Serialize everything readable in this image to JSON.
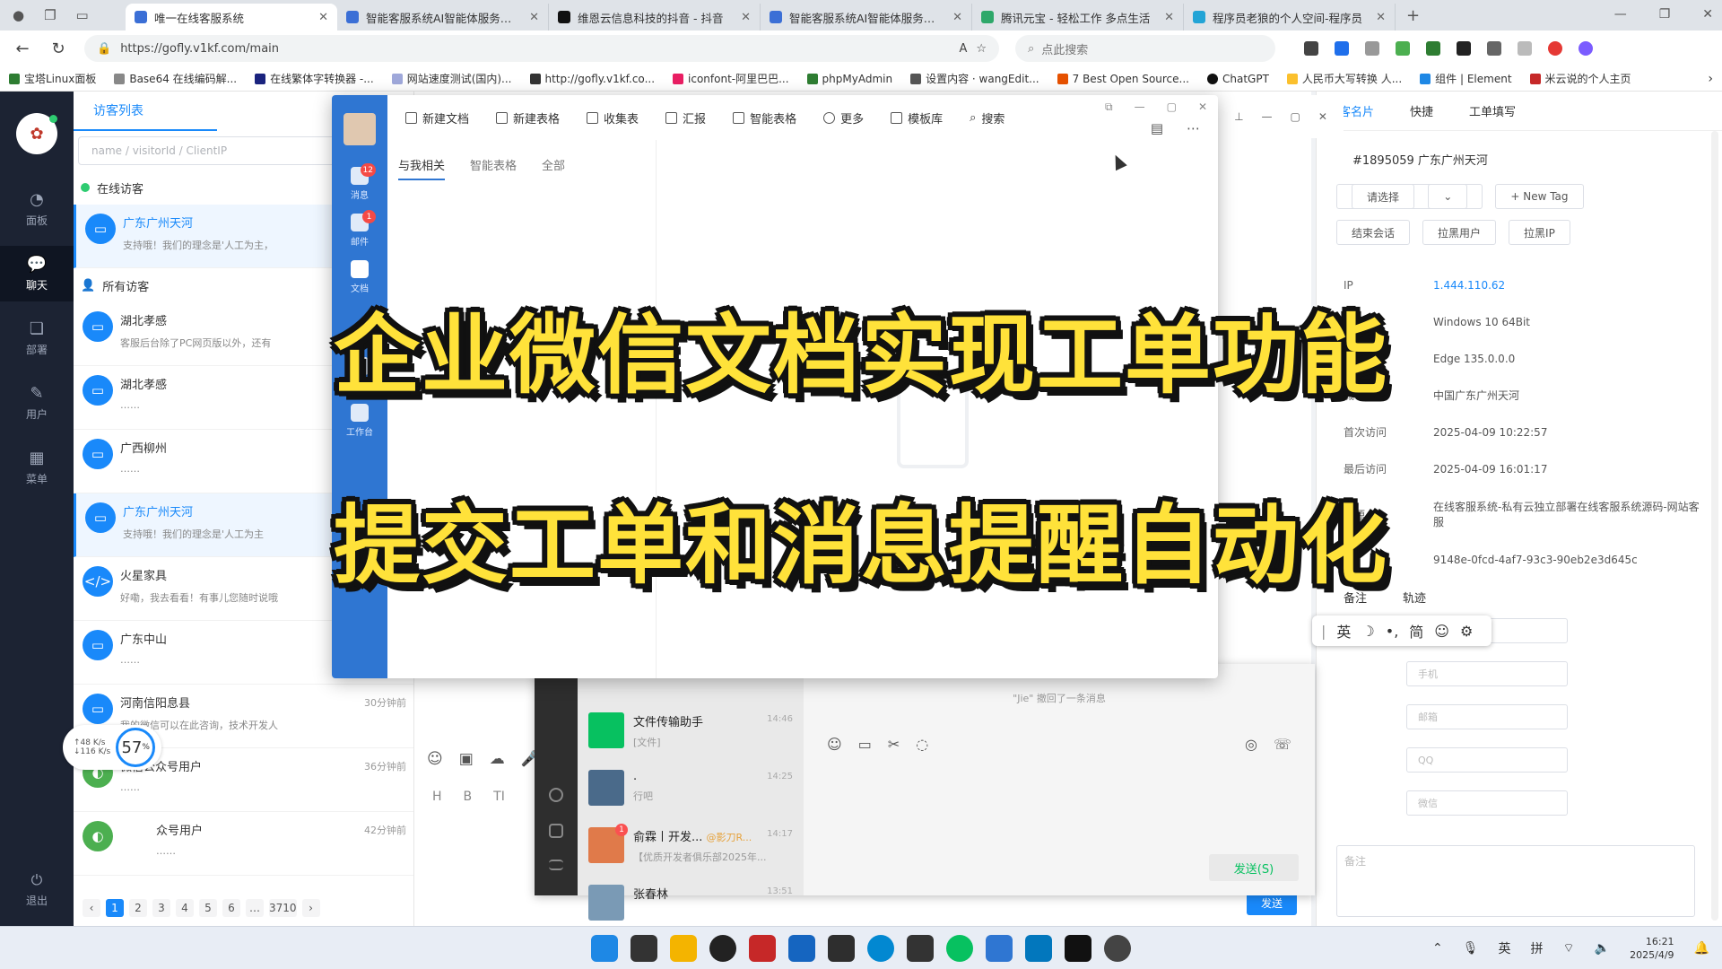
{
  "browser": {
    "tabs": [
      {
        "title": "唯一在线客服系统",
        "active": true
      },
      {
        "title": "智能客服系统AI智能体服务平台"
      },
      {
        "title": "维恩云信息科技的抖音 - 抖音"
      },
      {
        "title": "智能客服系统AI智能体服务平台"
      },
      {
        "title": "腾讯元宝 - 轻松工作 多点生活"
      },
      {
        "title": "程序员老狼的个人空间-程序员"
      }
    ],
    "url": "https://gofly.v1kf.com/main",
    "search_placeholder": "点此搜索",
    "bookmarks": [
      "宝塔Linux面板",
      "Base64 在线编码解...",
      "在线繁体字转换器 -...",
      "网站速度测试(国内)...",
      "http://gofly.v1kf.co...",
      "iconfont-阿里巴巴...",
      "phpMyAdmin",
      "设置内容 · wangEdit...",
      "7 Best Open Source...",
      "ChatGPT",
      "人民币大写转换 人...",
      "组件 | Element",
      "米云说的个人主页"
    ]
  },
  "leftnav": {
    "items": [
      {
        "label": "面板"
      },
      {
        "label": "聊天",
        "active": true
      },
      {
        "label": "部署"
      },
      {
        "label": "用户"
      },
      {
        "label": "菜单"
      }
    ],
    "logout": "退出"
  },
  "visitors": {
    "tab": "访客列表",
    "search_placeholder": "name / visitorId / ClientIP",
    "online_title": "在线访客",
    "all_title": "所有访客",
    "online": [
      {
        "name": "广东广州天河",
        "msg": "支持哦！我们的理念是'人工为主，"
      }
    ],
    "all": [
      {
        "name": "湖北孝感",
        "msg": "客服后台除了PC网页版以外，还有",
        "time": ""
      },
      {
        "name": "湖北孝感",
        "msg": "……",
        "time": ""
      },
      {
        "name": "广西柳州",
        "msg": "……",
        "time": ""
      },
      {
        "name": "广东广州天河",
        "msg": "支持哦！我们的理念是'人工为主",
        "time": ""
      },
      {
        "name": "火星家具",
        "msg": "好嘞，我去看看！有事儿您随时说哦",
        "time": ""
      },
      {
        "name": "广东中山",
        "msg": "……",
        "time": ""
      },
      {
        "name": "河南信阳息县",
        "msg": "我的微信可以在此咨询，技术开发人",
        "time": "30分钟前"
      },
      {
        "name": "微信公众号用户",
        "msg": "……",
        "time": "36分钟前"
      },
      {
        "name": "众号用户",
        "msg": "……",
        "time": "42分钟前"
      }
    ],
    "pager": [
      "‹",
      "1",
      "2",
      "3",
      "4",
      "5",
      "6",
      "…",
      "3710",
      "›"
    ],
    "speed_up": "↑48 K/s",
    "speed_down": "↓116 K/s",
    "speed_pct": "57",
    "speed_pct_unit": "%"
  },
  "chat": {
    "send": "发送",
    "tools": [
      "☺",
      "▣",
      "☁",
      "🎤"
    ],
    "format": [
      "H",
      "B",
      "TI"
    ]
  },
  "wechat": {
    "items": [
      {
        "name": "文件传输助手",
        "msg": "[文件]",
        "time": "14:46",
        "color": "#07c160"
      },
      {
        "name": ".",
        "msg": "行吧",
        "time": "14:25",
        "color": "#4a6a8a"
      },
      {
        "name": "俞霖丨开发...",
        "extra": "@影刀R...",
        "msg": "【优质开发者俱乐部2025年...",
        "time": "14:17",
        "badge": "1",
        "color": "#e07a4a"
      },
      {
        "name": "张春林",
        "msg": "",
        "time": "13:51",
        "color": "#7a9ab5"
      }
    ],
    "recall": "\"Jie\" 撤回了一条消息",
    "send": "发送(S)"
  },
  "wecom": {
    "side": [
      {
        "label": "消息",
        "badge": "12"
      },
      {
        "label": "邮件",
        "badge": "1"
      },
      {
        "label": "文档",
        "active": true
      },
      {
        "label": "会议"
      },
      {
        "label": "工作台"
      },
      {
        "label": "更多"
      }
    ],
    "toolbar": [
      "新建文档",
      "新建表格",
      "收集表",
      "汇报",
      "智能表格",
      "更多",
      "模板库",
      "搜索"
    ],
    "tabs": [
      "与我相关",
      "智能表格",
      "全部"
    ]
  },
  "right_panel": {
    "tabs": [
      "访客名片",
      "快捷",
      "工单填写"
    ],
    "visitor_id": "#1895059  广东广州天河",
    "tag_select": "请选择",
    "new_tag": "+ New Tag",
    "buttons": [
      "结束会话",
      "拉黑用户",
      "拉黑IP"
    ],
    "info": [
      {
        "k": "IP",
        "v": "1.444.110.62",
        "blue": true
      },
      {
        "k": "系统",
        "v": "Windows 10 64Bit"
      },
      {
        "k": "浏览器",
        "v": "Edge 135.0.0.0"
      },
      {
        "k": "城市",
        "v": "中国广东广州天河"
      },
      {
        "k": "首次访问",
        "v": "2025-04-09 10:22:57"
      },
      {
        "k": "最后访问",
        "v": "2025-04-09 16:01:17"
      },
      {
        "k": "来源",
        "v": "在线客服系统-私有云独立部署在线客服系统源码-网站客服"
      },
      {
        "k": "ID",
        "v": "9148e-0fcd-4af7-93c3-90eb2e3d645c"
      }
    ],
    "subtabs": [
      "备注",
      "轨迹"
    ],
    "form": [
      "姓名",
      "手机",
      "邮箱",
      "QQ",
      "微信"
    ],
    "note": "备注"
  },
  "ime": [
    "英",
    "☽",
    "•,",
    "简",
    "☺",
    "⚙"
  ],
  "overlay": {
    "line1": "企业微信文档实现工单功能",
    "line2": "提交工单和消息提醒自动化"
  },
  "taskbar": {
    "time": "16:21",
    "date": "2025/4/9",
    "ime1": "英",
    "ime2": "拼"
  }
}
